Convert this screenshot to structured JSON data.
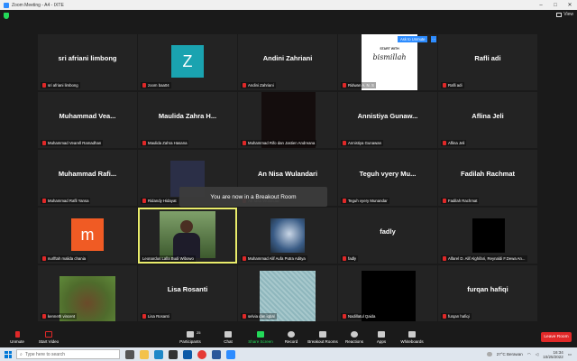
{
  "window": {
    "title": "Zoom Meeting - A4 - IXTE",
    "view_label": "View"
  },
  "toast": "You are now in a Breakout Room",
  "tiles": {
    "t1": {
      "big": "sri afriani limbong",
      "name": "sri afriani limbong"
    },
    "t2": {
      "big": "Z",
      "name": "zoom baa04"
    },
    "t3": {
      "big": "Andini Zahriani",
      "name": "Andini Zahriani"
    },
    "t4": {
      "name": "Ridwan A. N. S",
      "ask_unmute": "Ask to Unmute",
      "more": "···",
      "bg_line1": "START WITH",
      "bg_line2": "bismillah"
    },
    "t5": {
      "big": "Rafli adi",
      "name": "Rafli adi"
    },
    "t6": {
      "big": "Muhammad Vea...",
      "name": "Muhammad Vearell Ramadhan"
    },
    "t7": {
      "big": "Maulida Zahra H...",
      "name": "Maulida Zahra Hasana"
    },
    "t8": {
      "name": "Muhammad Rifo dan Jastien Andreana"
    },
    "t9": {
      "big": "Annistiya Gunaw...",
      "name": "Annistiya Gunawan"
    },
    "t10": {
      "big": "Aflina Jeli",
      "name": "Aflina Jeli"
    },
    "t11": {
      "big": "Muhammad Rafi...",
      "name": "Muhammad Rafli Yansa"
    },
    "t12": {
      "name": "Ridandy Hidayat"
    },
    "t13": {
      "big": "An Nisa Wulandari",
      "name": "An Nisa Wulandari"
    },
    "t14": {
      "big": "Teguh vyery Mu...",
      "name": "Teguh vyery Munandar"
    },
    "t15": {
      "big": "Fadilah Rachmat",
      "name": "Fadilah Rachmat"
    },
    "t16": {
      "big": "m",
      "name": "nurlftah malida chania"
    },
    "t17": {
      "name": "Leonardus Lalla Budi Wibowo"
    },
    "t18": {
      "name": "Muhammad Alif Aufa Putra Aditya"
    },
    "t19": {
      "big": "fadly",
      "name": "fadly"
    },
    "t20": {
      "name": "Alfarel D. Alif Alghifari, Reynaldi F.Dewa An..."
    },
    "t21": {
      "name": "kenneth vincent"
    },
    "t22": {
      "big": "Lisa Rosanti",
      "name": "Lisa Rosanti"
    },
    "t23": {
      "name": "selvia dan iqbal"
    },
    "t24": {
      "name": "Nadillatul Qaida"
    },
    "t25": {
      "big": "furqan hafiqi",
      "name": "furqan hafiqi"
    }
  },
  "toolbar": {
    "unmute": "Unmute",
    "start_video": "Start Video",
    "participants": "Participants",
    "participants_count": "25",
    "chat": "Chat",
    "share_screen": "Share Screen",
    "record": "Record",
    "breakout_rooms": "Breakout Rooms",
    "reactions": "Reactions",
    "apps": "Apps",
    "whiteboards": "Whiteboards",
    "leave": "Leave Room"
  },
  "taskbar": {
    "search_placeholder": "Type here to search",
    "weather": "27°C Berawan",
    "time": "16:34",
    "date": "10/25/2022"
  },
  "colors": {
    "accent": "#2d8cff",
    "leave": "#e02828",
    "active_speaker": "#e9ec6b",
    "share": "#23d959"
  }
}
